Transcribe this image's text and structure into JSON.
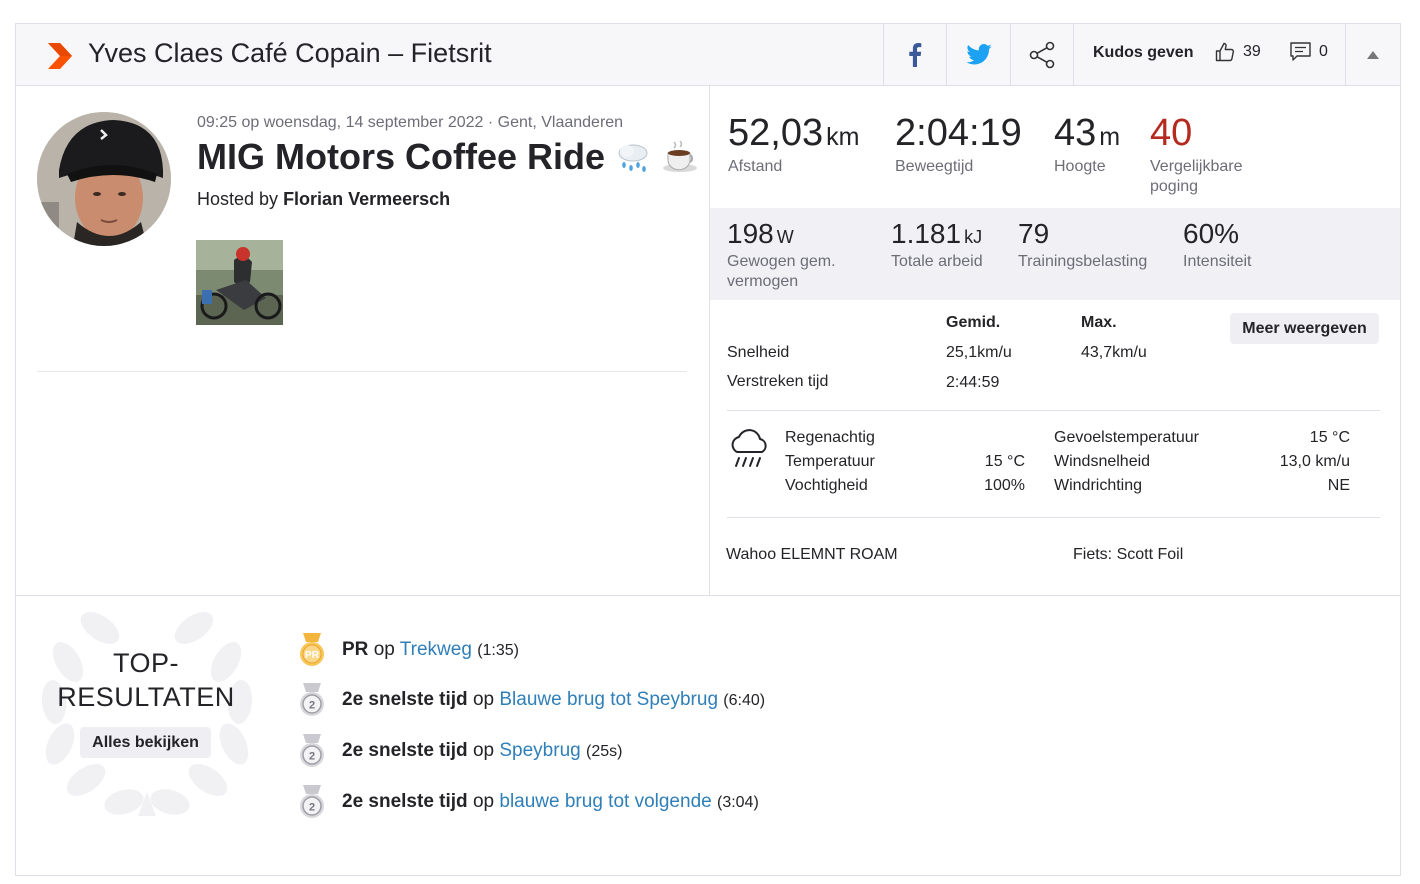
{
  "header": {
    "title": "Yves Claes Café Copain – Fietsrit",
    "kudos_label": "Kudos geven",
    "kudos_count": "39",
    "comment_count": "0"
  },
  "activity": {
    "meta": "09:25 op woensdag, 14 september 2022 · Gent, Vlaanderen",
    "title": "MIG Motors Coffee Ride",
    "hosted_prefix": "Hosted by",
    "host": "Florian Vermeersch"
  },
  "stats_primary": [
    {
      "value": "52,03",
      "unit": "km",
      "label": "Afstand"
    },
    {
      "value": "2:04:19",
      "unit": "",
      "label": "Beweegtijd"
    },
    {
      "value": "43",
      "unit": "m",
      "label": "Hoogte"
    },
    {
      "value": "40",
      "unit": "",
      "label_line1": "Vergelijkbare",
      "label_line2": "poging"
    }
  ],
  "stats_secondary": [
    {
      "value": "198",
      "unit": "W",
      "label_line1": "Gewogen gem.",
      "label_line2": "vermogen"
    },
    {
      "value": "1.181",
      "unit": "kJ",
      "label": "Totale arbeid"
    },
    {
      "value": "79",
      "unit": "",
      "label": "Trainingsbelasting"
    },
    {
      "value": "60%",
      "unit": "",
      "label": "Intensiteit"
    }
  ],
  "table": {
    "col_avg": "Gemid.",
    "col_max": "Max.",
    "more_button": "Meer weergeven",
    "rows": [
      {
        "label": "Snelheid",
        "avg": "25,1km/u",
        "max": "43,7km/u"
      },
      {
        "label": "Verstreken tijd",
        "avg": "2:44:59",
        "max": ""
      }
    ]
  },
  "weather": {
    "condition": "Regenachtig",
    "temp_label": "Temperatuur",
    "temp": "15 °C",
    "humidity_label": "Vochtigheid",
    "humidity": "100%",
    "feels_label": "Gevoelstemperatuur",
    "feels": "15 °C",
    "wind_speed_label": "Windsnelheid",
    "wind_speed": "13,0 km/u",
    "wind_dir_label": "Windrichting",
    "wind_dir": "NE"
  },
  "device": {
    "name": "Wahoo ELEMNT ROAM",
    "bike": "Fiets: Scott Foil"
  },
  "top_results": {
    "title_line1": "TOP-",
    "title_line2": "RESULTATEN",
    "all_button": "Alles bekijken",
    "items": [
      {
        "badge": "PR",
        "achievement": "PR",
        "connector": "op",
        "segment": "Trekweg",
        "time": "(1:35)"
      },
      {
        "badge": "2",
        "achievement": "2e snelste tijd",
        "connector": "op",
        "segment": "Blauwe brug tot Speybrug",
        "time": "(6:40)"
      },
      {
        "badge": "2",
        "achievement": "2e snelste tijd",
        "connector": "op",
        "segment": "Speybrug",
        "time": "(25s)"
      },
      {
        "badge": "2",
        "achievement": "2e snelste tijd",
        "connector": "op",
        "segment": "blauwe brug tot volgende",
        "time": "(3:04)"
      }
    ]
  },
  "colors": {
    "brand": "#fc5200",
    "link": "#2f7fb8",
    "accent_red": "#b52a1f",
    "facebook": "#3b5998",
    "twitter": "#1da1f2"
  }
}
